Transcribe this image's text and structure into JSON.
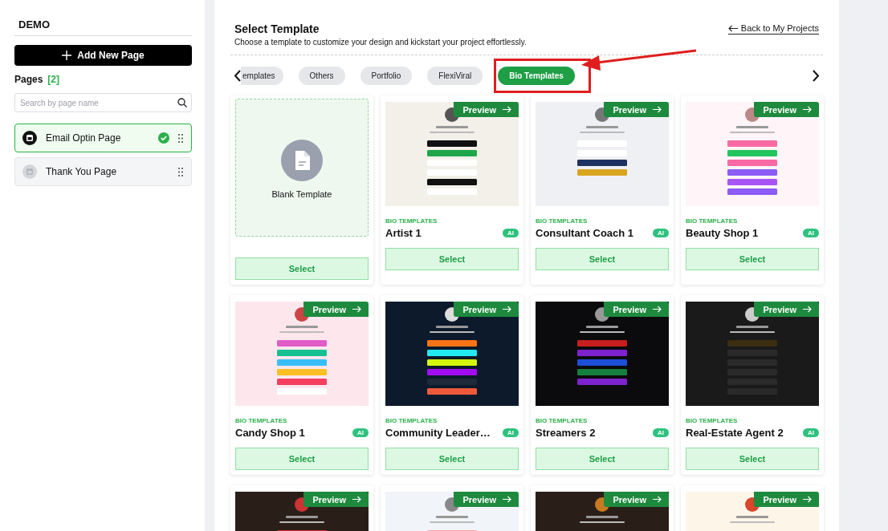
{
  "sidebar": {
    "project": "DEMO",
    "add_button": "Add New Page",
    "pages_label": "Pages",
    "pages_count": "[2]",
    "search": {
      "placeholder": "Search by page name"
    },
    "pages": [
      {
        "name": "Email Optin Page",
        "selected": true
      },
      {
        "name": "Thank You Page",
        "selected": false
      }
    ]
  },
  "header": {
    "title": "Select Template",
    "subtitle": "Choose a template to customize your design and kickstart your project effortlessly.",
    "back_link": "Back to My Projects"
  },
  "categories": [
    {
      "label": "emplates",
      "selected": false
    },
    {
      "label": "Others",
      "selected": false
    },
    {
      "label": "Portfolio",
      "selected": false
    },
    {
      "label": "FlexiViral",
      "selected": false
    },
    {
      "label": "Bio Templates",
      "selected": true
    }
  ],
  "templates": [
    {
      "kind": "blank",
      "label": "Blank Template",
      "button": "Select"
    },
    {
      "kind": "template",
      "preview": "Preview",
      "category": "BIO TEMPLATES",
      "title": "Artist 1",
      "badge": "AI",
      "button": "Select"
    },
    {
      "kind": "template",
      "preview": "Preview",
      "category": "BIO TEMPLATES",
      "title": "Consultant Coach 1",
      "badge": "AI",
      "button": "Select"
    },
    {
      "kind": "template",
      "preview": "Preview",
      "category": "BIO TEMPLATES",
      "title": "Beauty Shop 1",
      "badge": "AI",
      "button": "Select"
    },
    {
      "kind": "template",
      "preview": "Preview",
      "category": "BIO TEMPLATES",
      "title": "Candy Shop 1",
      "badge": "AI",
      "button": "Select"
    },
    {
      "kind": "template",
      "preview": "Preview",
      "category": "BIO TEMPLATES",
      "title": "Community Leader…",
      "badge": "AI",
      "button": "Select"
    },
    {
      "kind": "template",
      "preview": "Preview",
      "category": "BIO TEMPLATES",
      "title": "Streamers 2",
      "badge": "AI",
      "button": "Select"
    },
    {
      "kind": "template",
      "preview": "Preview",
      "category": "BIO TEMPLATES",
      "title": "Real-Estate Agent 2",
      "badge": "AI",
      "button": "Select"
    },
    {
      "kind": "template",
      "preview": "Preview"
    },
    {
      "kind": "template",
      "preview": "Preview"
    },
    {
      "kind": "template",
      "preview": "Preview"
    },
    {
      "kind": "template",
      "preview": "Preview"
    }
  ]
}
